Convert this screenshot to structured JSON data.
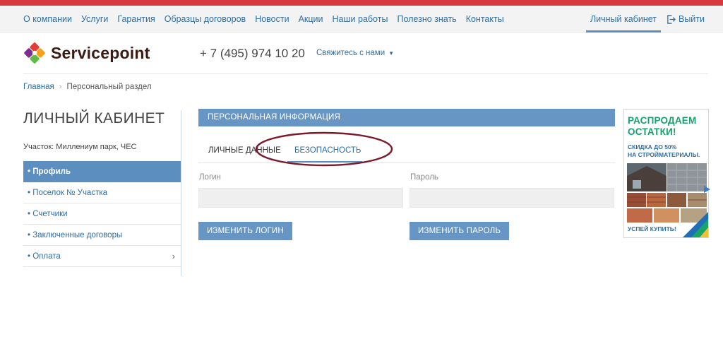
{
  "nav": {
    "links": [
      "О компании",
      "Услуги",
      "Гарантия",
      "Образцы договоров",
      "Новости",
      "Акции",
      "Наши работы",
      "Полезно знать",
      "Контакты"
    ],
    "cabinet": "Личный кабинет",
    "logout": "Выйти"
  },
  "header": {
    "logo_text": "Servicepoint",
    "phone": "+ 7 (495) 974 10 20",
    "contact_dropdown": "Свяжитесь с нами"
  },
  "breadcrumb": {
    "home": "Главная",
    "separator": "›",
    "current": "Персональный раздел"
  },
  "sidebar": {
    "title": "ЛИЧНЫЙ КАБИНЕТ",
    "plot": "Участок: Миллениум парк, ЧЕС",
    "items": [
      {
        "label": "• Профиль",
        "active": true
      },
      {
        "label": "• Поселок № Участка"
      },
      {
        "label": "• Счетчики"
      },
      {
        "label": "• Заключенные договоры"
      },
      {
        "label": "• Оплата",
        "chevron": "›"
      }
    ]
  },
  "panel": {
    "title": "ПЕРСОНАЛЬНАЯ ИНФОРМАЦИЯ",
    "tabs": {
      "personal": "ЛИЧНЫЕ ДАННЫЕ",
      "security": "БЕЗОПАСНОСТЬ",
      "active": "security"
    },
    "login_label": "Логин",
    "login_value": "",
    "password_label": "Пароль",
    "password_value": "",
    "change_login_button": "ИЗМЕНИТЬ ЛОГИН",
    "change_password_button": "ИЗМЕНИТЬ ПАРОЛЬ"
  },
  "ad": {
    "title_line1": "РАСПРОДАЕМ",
    "title_line2": "ОСТАТКИ!",
    "sub_line1": "СКИДКА ДО 50%",
    "sub_line2": "НА СТРОЙМАТЕРИАЛЫ.",
    "cta": "УСПЕЙ КУПИТЬ!"
  },
  "colors": {
    "accent": "#6896c4",
    "link": "#2f6ea4",
    "top_stripe": "#d8383f",
    "ad_green": "#17a06b",
    "annotation": "#7a1a2a"
  },
  "icons": {
    "logout": "logout-icon",
    "caret": "caret-down-icon",
    "chevron": "chevron-right-icon"
  }
}
